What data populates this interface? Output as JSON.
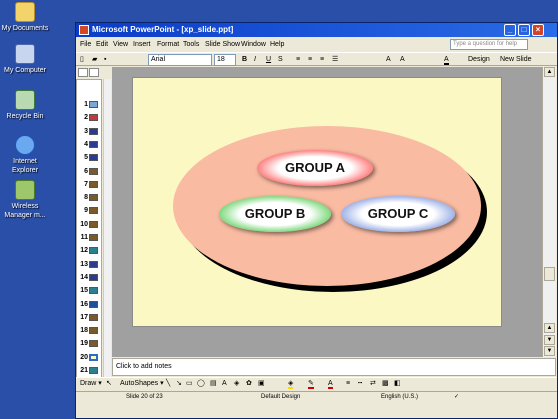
{
  "desktop": {
    "icons": [
      {
        "label": "My Documents",
        "icon": "folder-icon"
      },
      {
        "label": "My Computer",
        "icon": "computer-icon"
      },
      {
        "label": "Recycle Bin",
        "icon": "recycle-bin-icon"
      },
      {
        "label": "Internet Explorer",
        "icon": "ie-icon"
      },
      {
        "label": "Wireless Manager m...",
        "icon": "wireless-icon"
      }
    ]
  },
  "window": {
    "title": "Microsoft PowerPoint - [xp_slide.ppt]",
    "help_placeholder": "Type a question for help",
    "menu": [
      "File",
      "Edit",
      "View",
      "Insert",
      "Format",
      "Tools",
      "Slide Show",
      "Window",
      "Help"
    ],
    "font_name": "Arial",
    "font_size": "18",
    "design_label": "Design",
    "new_slide_label": "New Slide"
  },
  "outline": {
    "slides": [
      "1",
      "2",
      "3",
      "4",
      "5",
      "6",
      "7",
      "8",
      "9",
      "10",
      "11",
      "12",
      "13",
      "14",
      "15",
      "16",
      "17",
      "18",
      "19",
      "20",
      "21",
      "22"
    ],
    "active": "20"
  },
  "slide": {
    "groups": {
      "a": "GROUP A",
      "b": "GROUP B",
      "c": "GROUP C"
    }
  },
  "notes_placeholder": "Click to add notes",
  "drawbar": {
    "draw_label": "Draw",
    "autoshapes_label": "AutoShapes"
  },
  "status": {
    "slide_pos": "Slide 20 of 23",
    "design": "Default Design",
    "language": "English (U.S.)"
  },
  "colors": {
    "accent": "#0a3cc8",
    "group_a": "#d30000",
    "group_b": "#0e9b1a",
    "group_c": "#2a4fc7",
    "ellipse": "#f9bba2",
    "slide_bg": "#fcf8c4"
  }
}
